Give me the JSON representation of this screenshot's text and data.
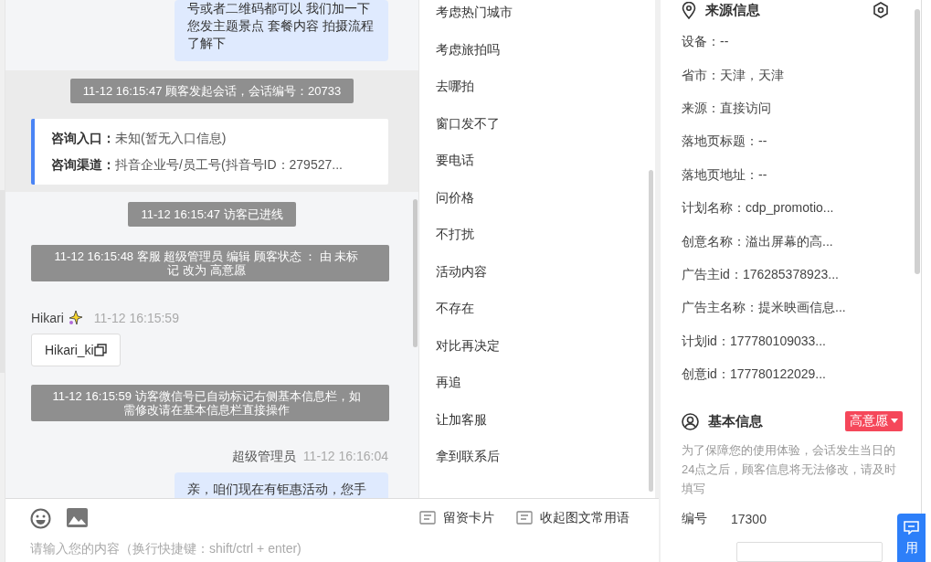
{
  "chat": {
    "messages": [
      {
        "kind": "bubble",
        "text": "号或者二维码都可以 我们加一下您发主题景点 套餐内容 拍摄流程了解下"
      },
      {
        "kind": "session",
        "text": "11-12 16:15:47 顾客发起会话，会话编号：20733",
        "fields": [
          {
            "label": "咨询入口：",
            "value": "未知(暂无入口信息)"
          },
          {
            "label": "咨询渠道：",
            "value": "抖音企业号/员工号(抖音号ID：279527..."
          }
        ]
      },
      {
        "kind": "system",
        "text": "11-12 16:15:47 访客已进线"
      },
      {
        "kind": "system",
        "text": "11-12 16:15:48 客服 超级管理员 编辑 顾客状态 ： 由 未标记 改为 高意愿"
      },
      {
        "kind": "visitor",
        "name": "Hikari",
        "time": "11-12 16:15:59",
        "card": "Hikari_ki"
      },
      {
        "kind": "system",
        "text": "11-12 16:15:59 访客微信号已自动标记右侧基本信息栏，如需修改请在基本信息栏直接操作"
      },
      {
        "kind": "agent",
        "name": "超级管理员",
        "time": "11-12 16:16:04",
        "text": "亲，咱们现在有钜惠活动，您手"
      }
    ],
    "input": {
      "placeholder": "请输入您的内容（换行快捷键：shift/ctrl + enter)"
    }
  },
  "phrases": {
    "items": [
      "考虑热门城市",
      "考虑旅拍吗",
      "去哪拍",
      "窗口发不了",
      "要电话",
      "问价格",
      "不打扰",
      "活动内容",
      "不存在",
      "对比再决定",
      "再追",
      "让加客服",
      "拿到联系后"
    ],
    "actions": [
      "留资卡片",
      "收起图文常用语"
    ]
  },
  "source_info": {
    "title": "来源信息",
    "rows": [
      "设备：--",
      "省市：天津，天津",
      "来源：直接访问",
      "落地页标题：--",
      "落地页地址：--",
      "计划名称：cdp_promotio...",
      "创意名称：溢出屏幕的高...",
      "广告主id：176285378923...",
      "广告主名称：提米映画信息...",
      "计划id：177780109033...",
      "创意id：177780122029..."
    ]
  },
  "basic_info": {
    "title": "基本信息",
    "status": "高意愿",
    "note": "为了保障您的使用体验，会话发生当日的24点之后，顾客信息将无法修改，请及时填写",
    "fields": [
      {
        "label": "编号",
        "value": "17300"
      }
    ]
  },
  "float_button": {
    "label": "用"
  }
}
